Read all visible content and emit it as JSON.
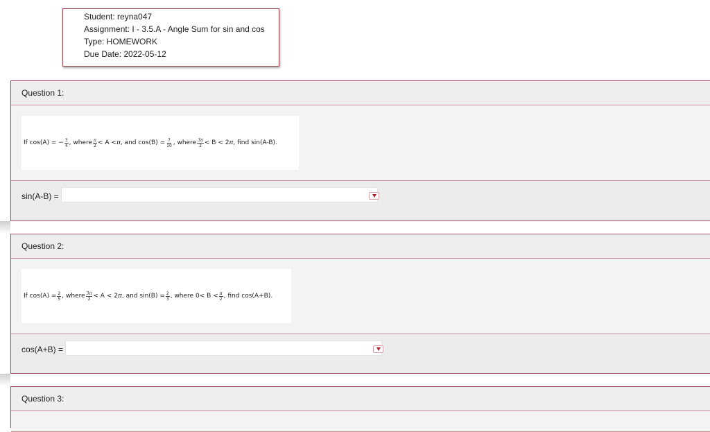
{
  "info": {
    "student": "Student: reyna047",
    "assignment": "Assignment: I - 3.5.A - Angle Sum for sin and cos",
    "type": "Type: HOMEWORK",
    "due_date": "Due Date: 2022-05-12"
  },
  "questions": [
    {
      "title": "Question 1:",
      "prompt": {
        "p1": "If cos(A) = −",
        "f1n": "3",
        "f1d": "4",
        "p2": ", where ",
        "f2n": "π",
        "f2d": "2",
        "p3": " < A < ",
        "pi1": "π",
        "p4": ", and cos(B) = ",
        "f3n": "7",
        "f3d": "10",
        "p5": ", where ",
        "f4n": "3π",
        "f4d": "2",
        "p6": " < B < 2",
        "pi2": "π",
        "p7": ", find sin(A-B)."
      },
      "answer_label": "sin(A-B) =",
      "answer_value": ""
    },
    {
      "title": "Question 2:",
      "prompt": {
        "p1": "If cos(A) = ",
        "f1n": "2",
        "f1d": "5",
        "p2": ", where ",
        "f2n": "3π",
        "f2d": "2",
        "p3": " < A < 2",
        "pi1": "π",
        "p4": ", and sin(B) = ",
        "f3n": "2",
        "f3d": "3",
        "p5": ", where 0< B < ",
        "f4n": "π",
        "f4d": "2",
        "p6": ", find cos(A+B)."
      },
      "answer_label": "cos(A+B) =",
      "answer_value": ""
    },
    {
      "title": "Question 3:"
    }
  ],
  "icons": {
    "dropdown": "caret-down-icon"
  }
}
